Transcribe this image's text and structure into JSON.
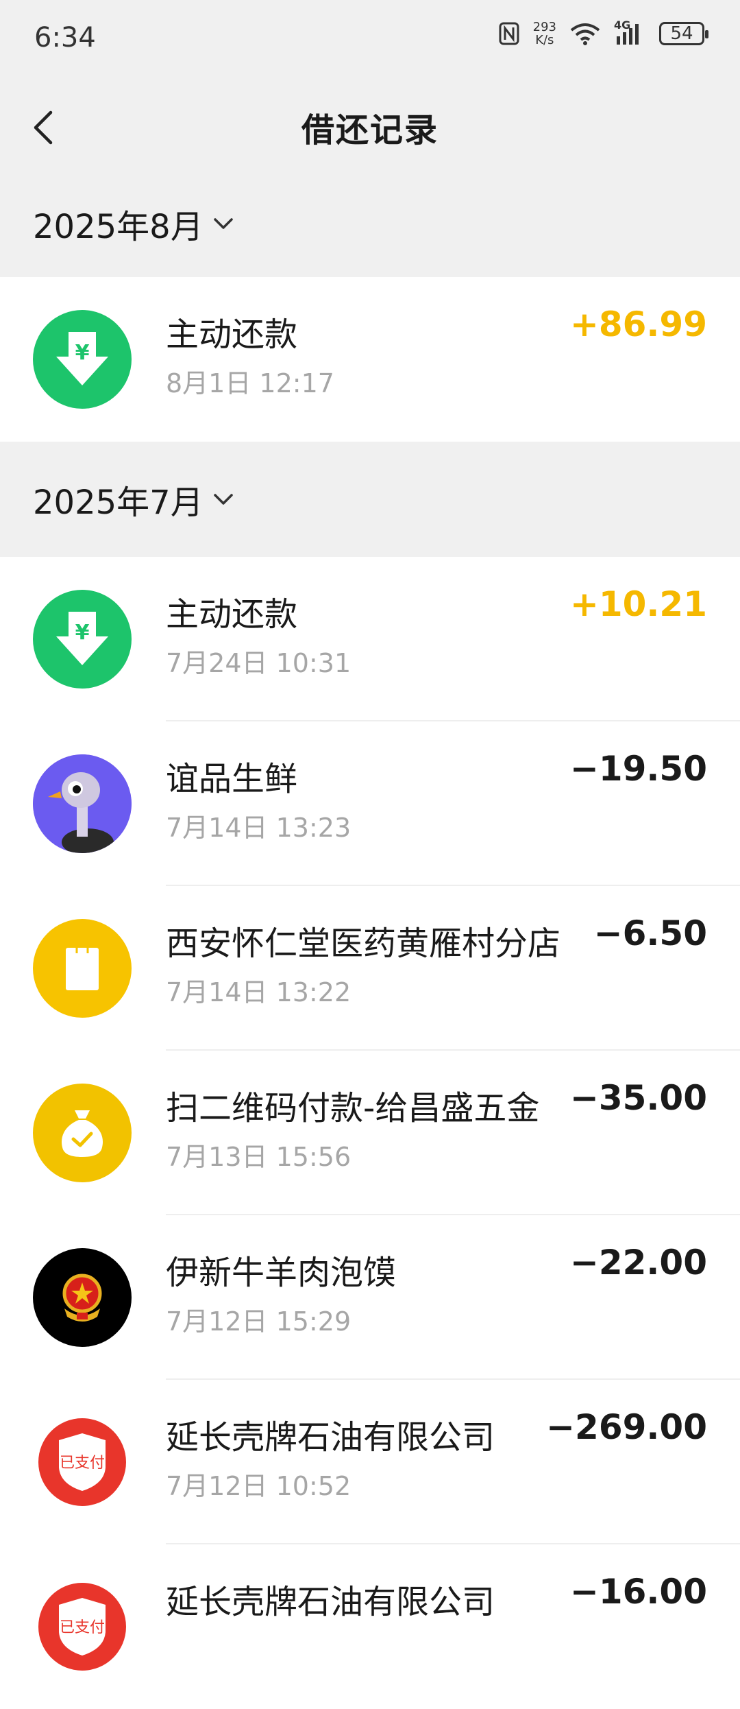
{
  "status": {
    "time": "6:34",
    "net_speed_value": "293",
    "net_speed_unit": "K/s",
    "network": "4G",
    "battery": "54"
  },
  "nav": {
    "title": "借还记录"
  },
  "groups": [
    {
      "month": "2025年8月",
      "items": [
        {
          "title": "主动还款",
          "date": "8月1日 12:17",
          "amount": "+86.99",
          "icon": "repay-arrow-icon"
        }
      ]
    },
    {
      "month": "2025年7月",
      "items": [
        {
          "title": "主动还款",
          "date": "7月24日 10:31",
          "amount": "+10.21",
          "icon": "repay-arrow-icon"
        },
        {
          "title": "谊品生鲜",
          "date": "7月14日 13:23",
          "amount": "−19.50",
          "icon": "ostrich-avatar-icon"
        },
        {
          "title": "西安怀仁堂医药黄雁村分店",
          "date": "7月14日 13:22",
          "amount": "−6.50",
          "icon": "shopping-bag-icon"
        },
        {
          "title": "扫二维码付款-给昌盛五金",
          "date": "7月13日 15:56",
          "amount": "−35.00",
          "icon": "money-bag-icon"
        },
        {
          "title": "伊新牛羊肉泡馍",
          "date": "7月12日 15:29",
          "amount": "−22.00",
          "icon": "emblem-icon"
        },
        {
          "title": "延长壳牌石油有限公司",
          "date": "7月12日 10:52",
          "amount": "−269.00",
          "icon": "paid-shield-icon"
        },
        {
          "title": "延长壳牌石油有限公司",
          "date": "",
          "amount": "−16.00",
          "icon": "paid-shield-icon"
        }
      ]
    }
  ],
  "icon_labels": {
    "paid": "已支付",
    "yen": "¥"
  },
  "colors": {
    "positive": "#f5b800",
    "green": "#1dc46b",
    "yellow": "#f7c300",
    "red": "#e8352b"
  }
}
